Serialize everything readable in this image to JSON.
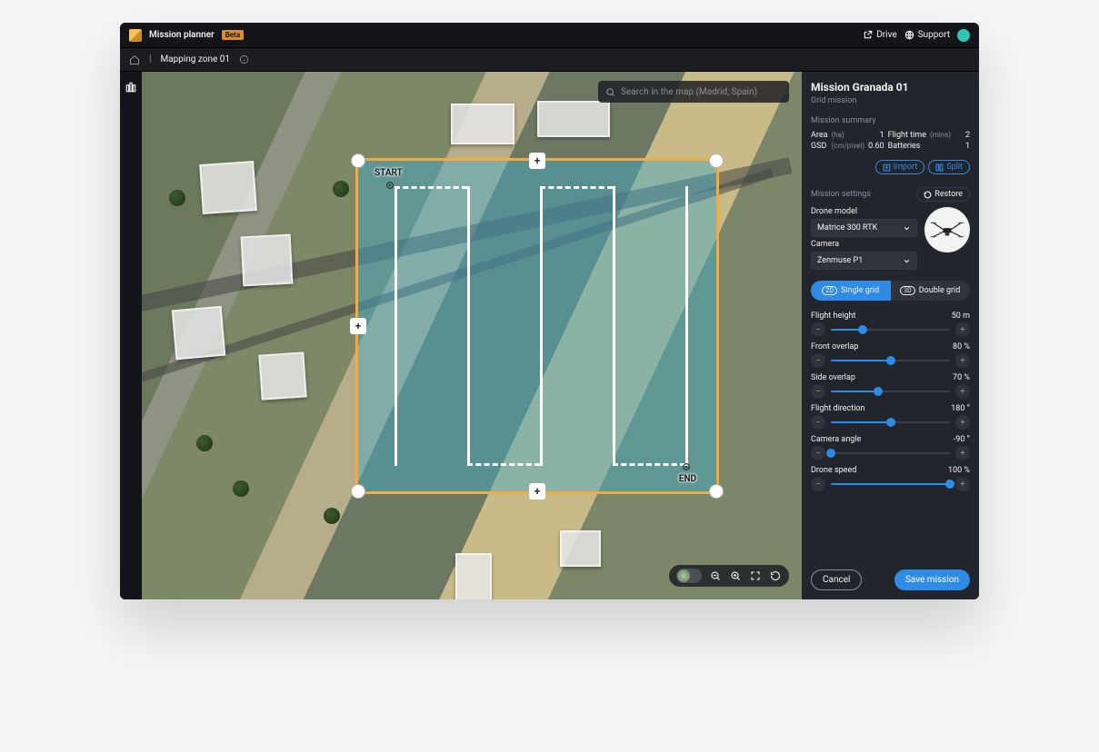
{
  "header": {
    "app_title": "Mission planner",
    "beta": "Beta",
    "drive": "Drive",
    "support": "Support"
  },
  "breadcrumb": {
    "zone": "Mapping zone 01"
  },
  "search": {
    "placeholder": "Search in the map (Madrid, Spain)"
  },
  "mission": {
    "title": "Mission Granada 01",
    "subtitle": "Grid mission",
    "summary_label": "Mission summary",
    "area_label": "Area",
    "area_unit": "(ha)",
    "area_value": "1",
    "flight_time_label": "Flight time",
    "flight_time_unit": "(mins)",
    "flight_time_value": "2",
    "gsd_label": "GSD",
    "gsd_unit": "(cm/pixel)",
    "gsd_value": "0.60",
    "batteries_label": "Batteries",
    "batteries_value": "1",
    "import": "Import",
    "split": "Split",
    "settings_label": "Mission settings",
    "restore": "Restore",
    "drone_model_label": "Drone model",
    "drone_model": "Matrice 300 RTK",
    "camera_label": "Camera",
    "camera": "Zenmuse P1",
    "grid_single": "Single grid",
    "grid_single_tag": "2D",
    "grid_double": "Double grid",
    "grid_double_tag": "3D",
    "cancel": "Cancel",
    "save": "Save mission"
  },
  "sliders": {
    "flight_height": {
      "label": "Flight height",
      "value": "50 m",
      "pct": 27
    },
    "front_overlap": {
      "label": "Front overlap",
      "value": "80 %",
      "pct": 50
    },
    "side_overlap": {
      "label": "Side overlap",
      "value": "70 %",
      "pct": 40
    },
    "flight_direction": {
      "label": "Flight direction",
      "value": "180 °",
      "pct": 50
    },
    "camera_angle": {
      "label": "Camera angle",
      "value": "-90 °",
      "pct": 0
    },
    "drone_speed": {
      "label": "Drone speed",
      "value": "100 %",
      "pct": 100
    }
  },
  "overlay": {
    "start": "START",
    "end": "END"
  }
}
